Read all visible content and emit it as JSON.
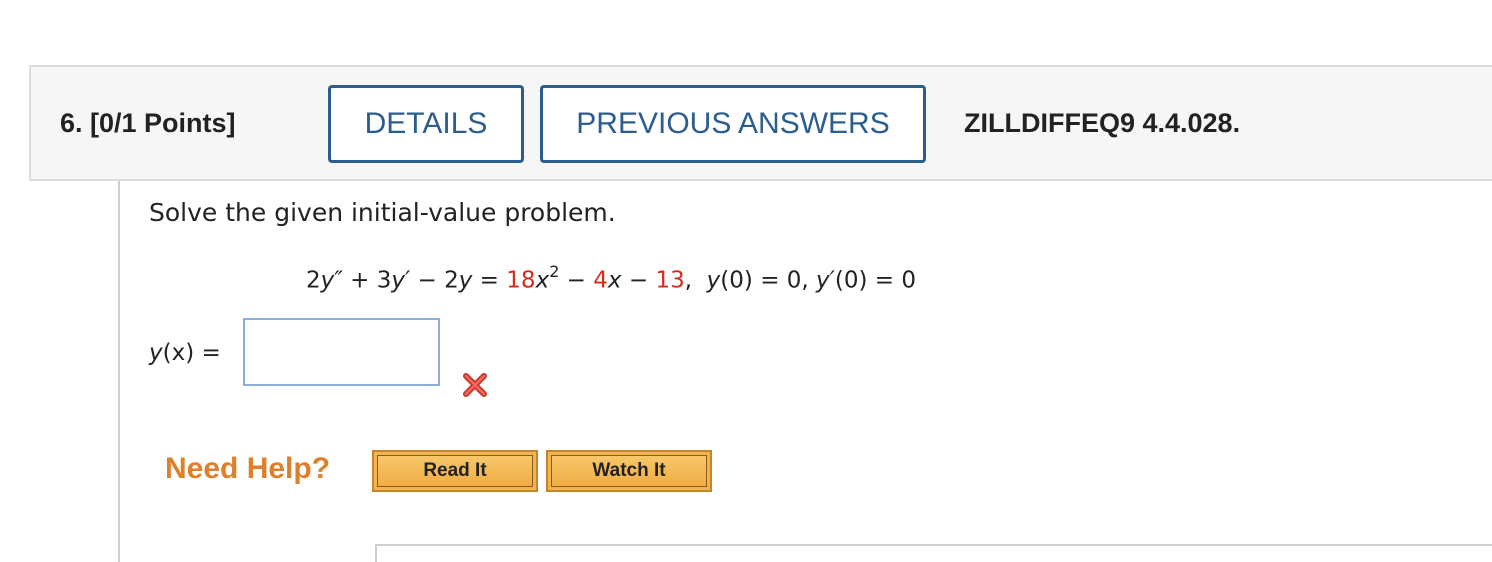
{
  "question": {
    "number_points": "6. [0/1 Points]",
    "details_label": "DETAILS",
    "previous_answers_label": "PREVIOUS ANSWERS",
    "reference": "ZILLDIFFEQ9 4.4.028."
  },
  "problem": {
    "prompt": "Solve the given initial-value problem.",
    "eq": {
      "lhs_a": "2",
      "lhs_b": "y″",
      "lhs_c": " + 3",
      "lhs_d": "y′",
      "lhs_e": " − 2",
      "lhs_f": "y",
      "equals": " = ",
      "coef1": "18",
      "x1": "x",
      "exp": "2",
      "minus1": " − ",
      "coef2": "4",
      "x2": "x",
      "minus2": " − ",
      "const": "13",
      "comma": ",  ",
      "ic1_fn": "y",
      "ic1_rest": "(0) = 0, ",
      "ic2_fn": "y′",
      "ic2_rest": "(0) = 0"
    },
    "coefficient_color": "#d52b1e"
  },
  "answer": {
    "label_fn": "y",
    "label_rest": "(x) =",
    "value": "",
    "status_icon": "incorrect-x-icon"
  },
  "help": {
    "label": "Need Help?",
    "read_it": "Read It",
    "watch_it": "Watch It"
  },
  "colors": {
    "button_border": "#2b5d8e",
    "help_orange": "#e07f2a",
    "incorrect_red": "#d52b1e"
  }
}
